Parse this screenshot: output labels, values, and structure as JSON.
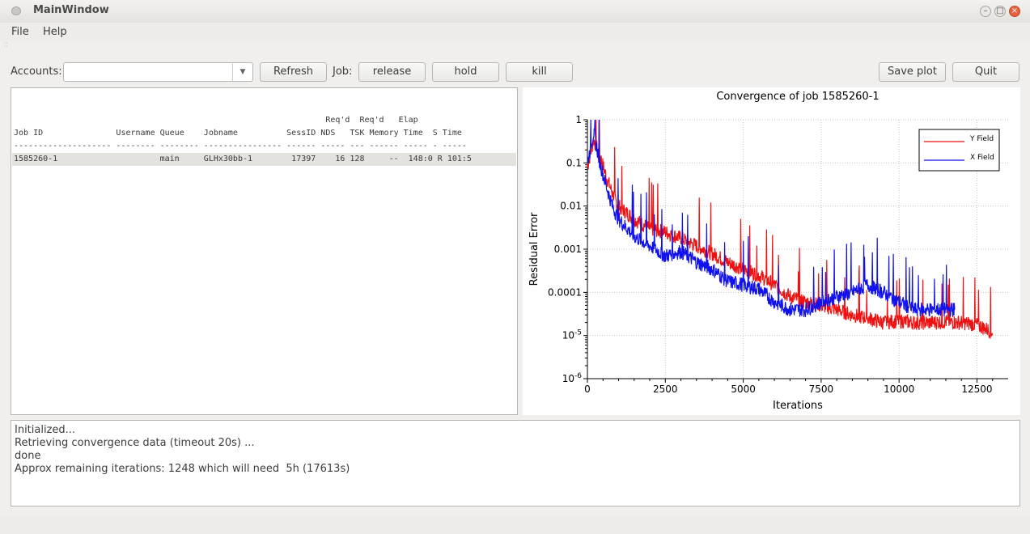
{
  "window": {
    "title": "MainWindow"
  },
  "menu": {
    "file": "File",
    "help": "Help"
  },
  "toolbar": {
    "accounts_label": "Accounts:",
    "accounts_value": "",
    "refresh": "Refresh",
    "job_label": "Job:",
    "release": "release",
    "hold": "hold",
    "kill": "kill",
    "save_plot": "Save plot",
    "quit": "Quit"
  },
  "jobs": {
    "header_line1": "                                                                Req'd  Req'd   Elap",
    "header_line2": "Job ID               Username Queue    Jobname          SessID NDS   TSK Memory Time  S Time",
    "separator": "-------------------- -------- -------- ---------------- ------ ----- --- ------ ----- - -----",
    "rows": [
      {
        "text": "1585260-1                     main     GLHx30bb-1        17397    16 128     --  148:0 R 101:5"
      }
    ]
  },
  "chart_data": {
    "type": "line",
    "title": "Convergence of job 1585260-1",
    "xlabel": "Iterations",
    "ylabel": "Residual Error",
    "xlim": [
      0,
      13500
    ],
    "ylim": [
      1e-06,
      1
    ],
    "yscale": "log",
    "xticks": [
      "0",
      "2500",
      "5000",
      "7500",
      "10000",
      "12500"
    ],
    "yticks": [
      "1",
      "0.1",
      "0.01",
      "0.001",
      "0.0001",
      "10^-5",
      "10^-6"
    ],
    "grid": true,
    "legend_position": "top-right",
    "series": [
      {
        "name": "Y Field",
        "color": "#ee1111",
        "x": [
          0,
          200,
          400,
          600,
          800,
          1000,
          1500,
          2000,
          2500,
          3000,
          3500,
          4000,
          4500,
          5000,
          5500,
          6000,
          6500,
          7000,
          7500,
          8000,
          8500,
          9000,
          9500,
          10000,
          10500,
          11000,
          11500,
          12000,
          12500,
          13000
        ],
        "y": [
          0.08,
          0.35,
          0.15,
          0.05,
          0.02,
          0.01,
          0.005,
          0.003,
          0.0025,
          0.0018,
          0.0012,
          0.0008,
          0.0005,
          0.00035,
          0.00025,
          0.00015,
          8e-05,
          6e-05,
          5e-05,
          4e-05,
          3e-05,
          2.5e-05,
          2e-05,
          2.2e-05,
          2e-05,
          2e-05,
          2.1e-05,
          2e-05,
          1.8e-05,
          1.2e-05
        ]
      },
      {
        "name": "X Field",
        "color": "#1111ee",
        "x": [
          0,
          200,
          400,
          600,
          800,
          1000,
          1500,
          2000,
          2500,
          3000,
          3500,
          4000,
          4500,
          5000,
          5500,
          6000,
          6500,
          7000,
          7500,
          8000,
          8500,
          9000,
          9500,
          10000,
          10500,
          11000,
          11500,
          11800
        ],
        "y": [
          0.1,
          0.5,
          0.1,
          0.03,
          0.01,
          0.005,
          0.002,
          0.0012,
          0.0007,
          0.0009,
          0.0005,
          0.00035,
          0.00018,
          0.00015,
          0.00012,
          6e-05,
          4e-05,
          4e-05,
          6e-05,
          8e-05,
          0.0001,
          0.00015,
          0.0001,
          6e-05,
          4e-05,
          4e-05,
          4e-05,
          4e-05
        ]
      }
    ]
  },
  "log": {
    "lines": [
      "Initialized...",
      "Retrieving convergence data (timeout 20s) ...",
      "done",
      "Approx remaining iterations: 1248 which will need  5h (17613s)"
    ]
  }
}
